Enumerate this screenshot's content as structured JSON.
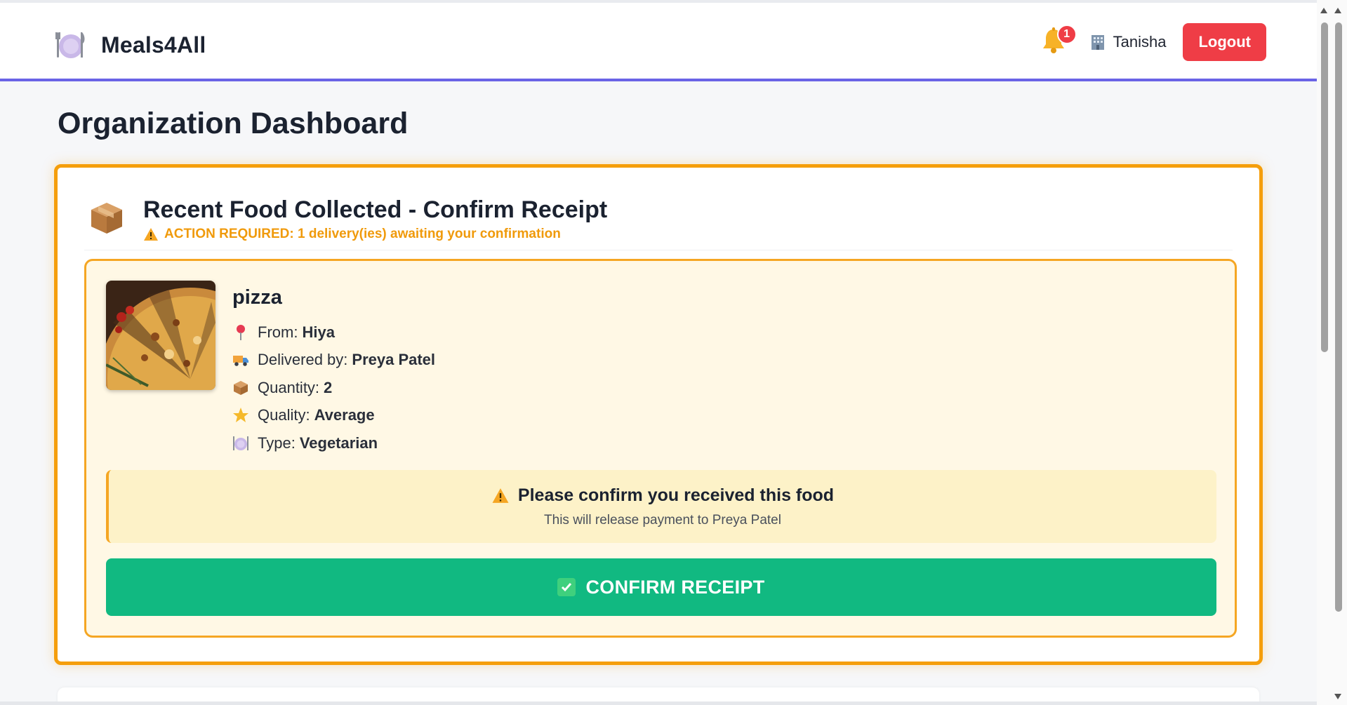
{
  "app": {
    "brand_name": "Meals4All",
    "notification_count": "1",
    "user_name": "Tanisha",
    "logout_label": "Logout"
  },
  "page": {
    "title": "Organization Dashboard"
  },
  "card": {
    "title": "Recent Food Collected - Confirm Receipt",
    "action_required": "ACTION REQUIRED: 1 delivery(ies) awaiting your confirmation"
  },
  "delivery": {
    "food_name": "pizza",
    "details": [
      {
        "icon": "pin-icon",
        "label": "From:",
        "value": "Hiya"
      },
      {
        "icon": "truck-icon",
        "label": "Delivered by:",
        "value": "Preya Patel"
      },
      {
        "icon": "package-icon",
        "label": "Quantity:",
        "value": "2"
      },
      {
        "icon": "star-icon",
        "label": "Quality:",
        "value": "Average"
      },
      {
        "icon": "plate-icon",
        "label": "Type:",
        "value": "Vegetarian"
      }
    ],
    "notice_title": "Please confirm you received this food",
    "notice_sub": "This will release payment to Preya Patel",
    "confirm_label": "CONFIRM RECEIPT"
  },
  "colors": {
    "accent": "#6a63e6",
    "danger": "#ef3d46",
    "warning": "#f59e0b",
    "success": "#11b981"
  }
}
